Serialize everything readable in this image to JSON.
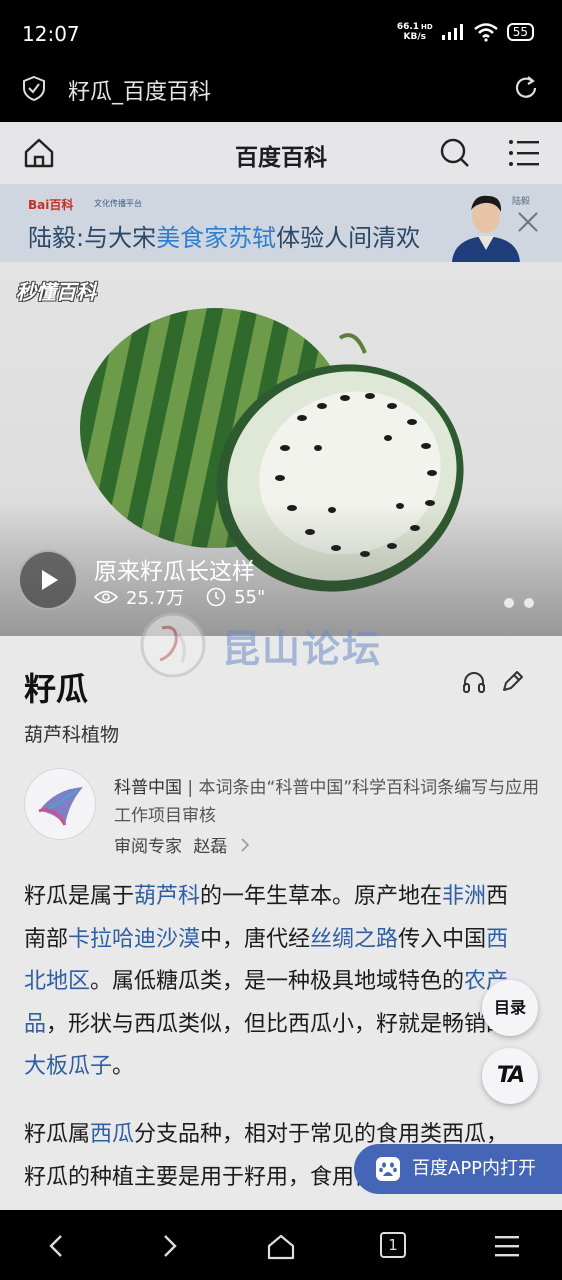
{
  "status_bar": {
    "time": "12:07",
    "net_speed_value": "66.1",
    "net_speed_unit": "KB/s",
    "hd_label": "HD",
    "battery": "55"
  },
  "browser": {
    "page_title": "籽瓜_百度百科"
  },
  "nav": {
    "title": "百度百科"
  },
  "banner": {
    "logo": "Bai百科",
    "partner": "文化传播平台",
    "headline_prefix": "陆毅:与大宋",
    "headline_highlight": "美食家苏轼",
    "headline_suffix": "体验人间清欢",
    "side_tag": "陆毅"
  },
  "hero": {
    "brand": "秒懂百科",
    "video_title": "原来籽瓜长这样",
    "views": "25.7万",
    "duration": "55\""
  },
  "watermark": {
    "text": "昆山论坛"
  },
  "entry": {
    "title": "籽瓜",
    "subtitle": "葫芦科植物"
  },
  "author": {
    "org": "科普中国",
    "desc": "本词条由“科普中国”科学百科词条编写与应用工作项目审核",
    "reviewer_label": "审阅专家",
    "reviewer_name": "赵磊"
  },
  "paragraph1": {
    "t1": "籽瓜是属于",
    "l1": "葫芦科",
    "t2": "的一年生草本。原产地在",
    "l2": "非洲",
    "t3": "西南部",
    "l3": "卡拉哈迪沙漠",
    "t4": "中，唐代经",
    "l4": "丝绸之路",
    "t5": "传入中国",
    "l5": "西北地区",
    "t6": "。属低糖瓜类，是一种极具地域特色的",
    "l6": "农产品",
    "t7": "，形状与西瓜类似，但比西瓜小，籽就是畅销的",
    "l7": "大板瓜子",
    "t8": "。"
  },
  "paragraph2": {
    "t1": "籽瓜属",
    "l1": "西瓜",
    "t2": "分支品种，相对于常见的食用类西瓜，籽瓜的种植主要是用于",
    "t3": "籽用，食用价值较低。"
  },
  "floating": {
    "toc_label": "目录",
    "font_label": "TA",
    "open_app_label": "百度APP内打开"
  },
  "icons": [
    "shield-icon",
    "refresh-icon",
    "home-icon",
    "search-icon",
    "menu-icon",
    "headphones-icon",
    "edit-icon",
    "play-icon",
    "eye-icon",
    "clock-icon",
    "close-icon",
    "paw-icon",
    "back-icon",
    "forward-icon",
    "tabs-icon",
    "more-icon"
  ],
  "bottom_nav": {
    "tab_count": "1"
  }
}
